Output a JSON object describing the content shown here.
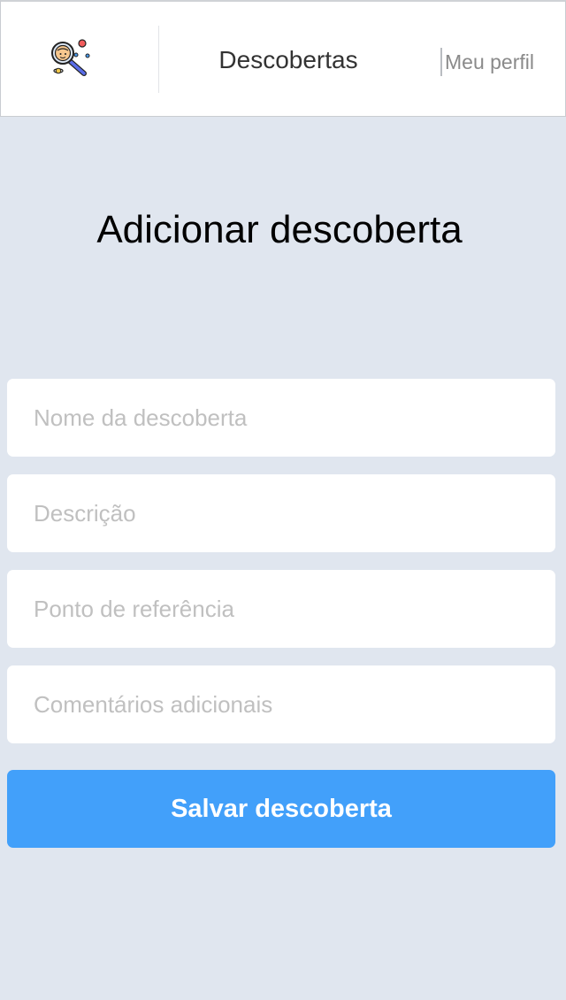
{
  "header": {
    "logo_icon": "magnifier-discovery-icon",
    "nav_title": "Descobertas",
    "profile_link": "Meu perfil"
  },
  "main": {
    "title": "Adicionar descoberta",
    "fields": [
      {
        "placeholder": "Nome da descoberta"
      },
      {
        "placeholder": "Descrição"
      },
      {
        "placeholder": "Ponto de referência"
      },
      {
        "placeholder": "Comentários adicionais"
      }
    ],
    "save_label": "Salvar descoberta"
  },
  "colors": {
    "background": "#e0e6ef",
    "header_bg": "#ffffff",
    "accent": "#42a0fa",
    "placeholder": "#c0c0c0"
  }
}
